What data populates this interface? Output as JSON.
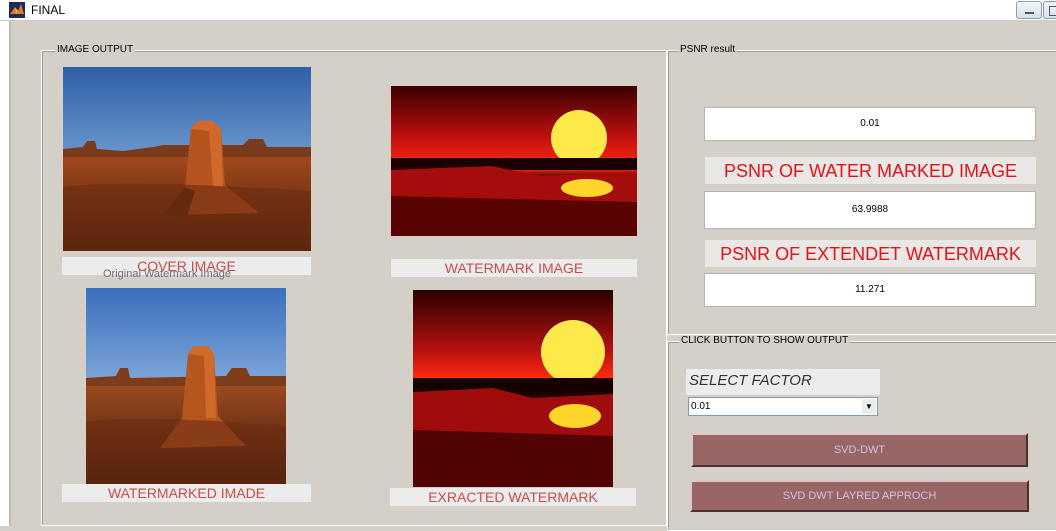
{
  "window": {
    "title": "FINAL",
    "icon": "matlab-icon"
  },
  "image_output": {
    "title": "IMAGE OUTPUT",
    "cover_caption": "COVER IMAGE",
    "cover_subcaption": "Original Watermark Image",
    "watermark_caption": "WATERMARK IMAGE",
    "watermarked_caption": "WATERMARKED IMADE",
    "extracted_caption": "EXRACTED WATERMARK"
  },
  "psnr": {
    "title": "PSNR result",
    "factor_value": "0.01",
    "psnr_watermarked_label": "PSNR OF WATER MARKED IMAGE",
    "psnr_watermarked_value": "63.9988",
    "psnr_extracted_label": "PSNR OF EXTENDET WATERMARK",
    "psnr_extracted_value": "11.271"
  },
  "controls": {
    "title": "CLICK  BUTTON TO SHOW OUTPUT",
    "select_label": "SELECT FACTOR",
    "select_value": "0.01",
    "svd_dwt_label": "SVD-DWT",
    "svd_layered_label": "SVD DWT LAYRED APPROCH"
  },
  "colors": {
    "panel_bg": "#d4d0c8",
    "caption_text": "#cc4b4b",
    "psnr_label_text": "#e8101a",
    "button_bg": "#9a6565",
    "button_text": "#d0c3e6"
  }
}
